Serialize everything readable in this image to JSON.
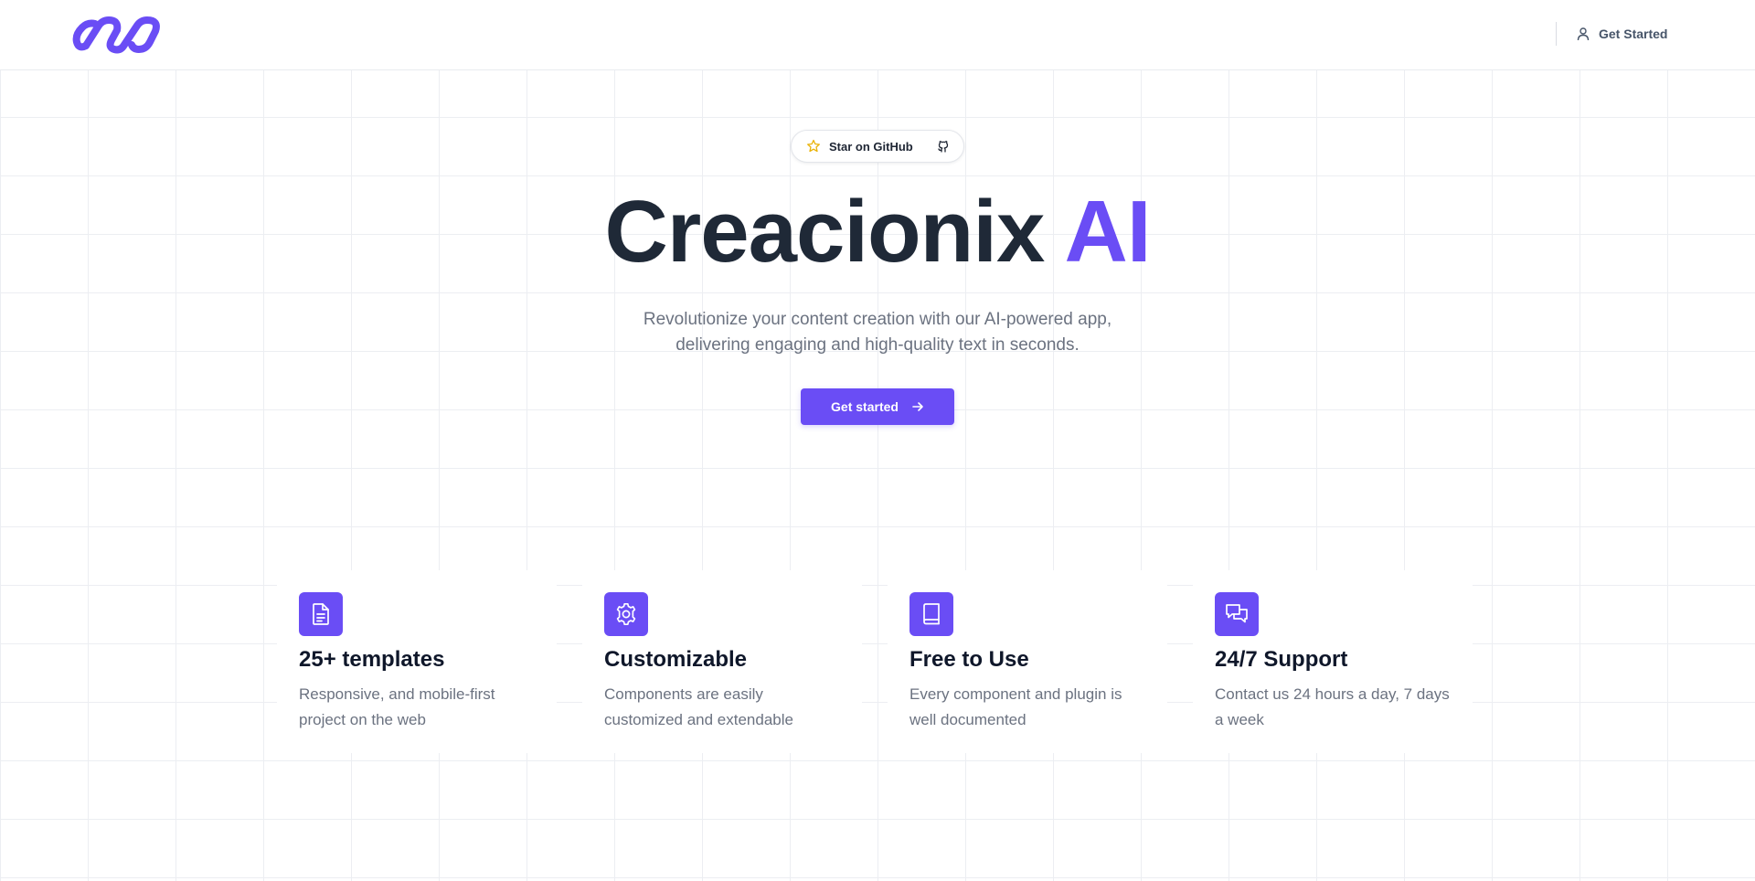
{
  "header": {
    "logo_icon": "infinity-chain-logo",
    "cta_icon": "user-icon",
    "cta_label": "Get Started"
  },
  "hero": {
    "badge": {
      "star_icon": "star-icon",
      "label": "Star on GitHub",
      "github_icon": "github-icon"
    },
    "title_main": "Creacionix ",
    "title_accent": "AI",
    "subtitle_line1": "Revolutionize your content creation with our AI-powered app,",
    "subtitle_line2": "delivering engaging and high-quality text in seconds.",
    "cta_label": "Get started",
    "cta_icon": "arrow-right-icon"
  },
  "features": [
    {
      "icon": "document-icon",
      "title": "25+ templates",
      "desc": "Responsive, and mobile-first project on the web"
    },
    {
      "icon": "gear-icon",
      "title": "Customizable",
      "desc": "Components are easily customized and extendable"
    },
    {
      "icon": "book-icon",
      "title": "Free to Use",
      "desc": "Every component and plugin is well documented"
    },
    {
      "icon": "chat-icon",
      "title": "24/7 Support",
      "desc": "Contact us 24 hours a day, 7 days a week"
    }
  ],
  "colors": {
    "accent": "#6a4df5",
    "heading": "#1f2937",
    "muted": "#6b7280",
    "grid": "#eceef2"
  }
}
